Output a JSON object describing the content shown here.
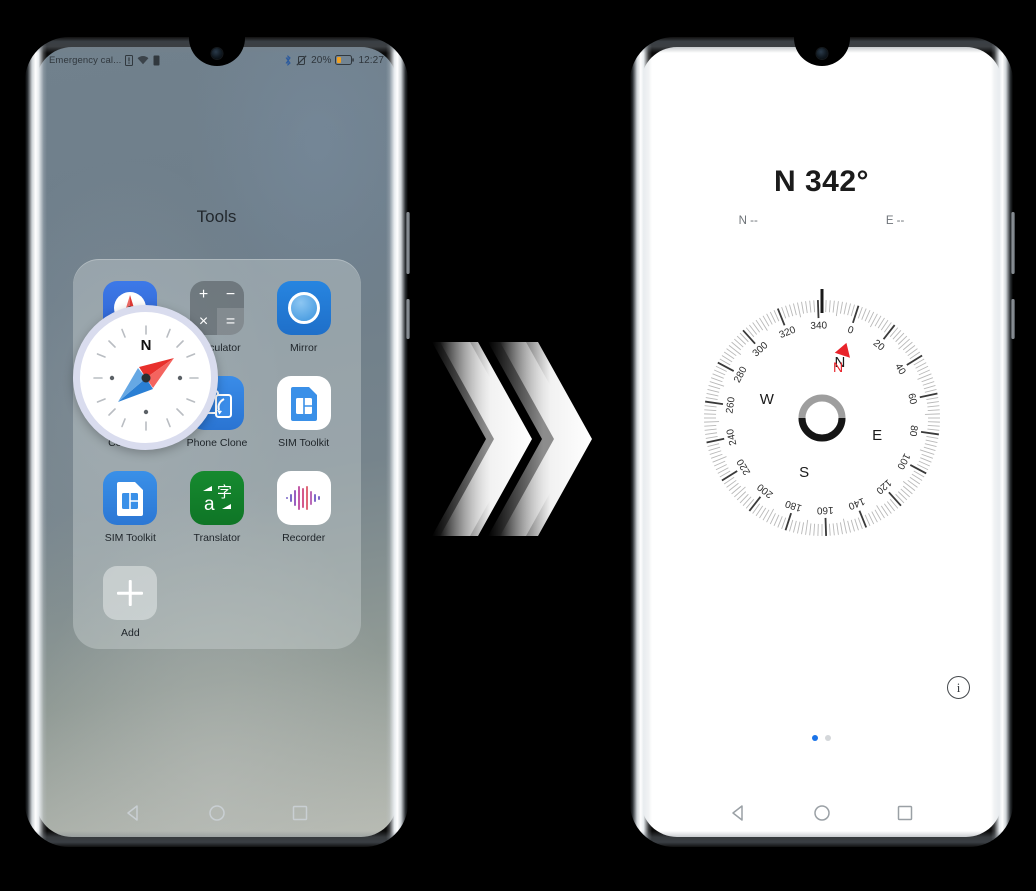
{
  "scene": {
    "title": "Huawei compass app launch flow",
    "accent_blue": "#1a73e8",
    "north_red": "#e8232a"
  },
  "left_phone": {
    "status_bar": {
      "carrier": "Emergency cal...",
      "no_sim_icon": "sim-alert-icon",
      "wifi_icon": "wifi-icon",
      "signal_icon": "signal-bar-icon",
      "bluetooth_icon": "bluetooth-icon",
      "mute_icon": "vibrate-off-icon",
      "battery_percent": "20%",
      "battery_icon": "battery-low-icon",
      "clock": "12:27"
    },
    "folder": {
      "title": "Tools",
      "apps": [
        {
          "label": "Compass",
          "icon": "compass-icon"
        },
        {
          "label": "Calculator",
          "icon": "calculator-icon"
        },
        {
          "label": "Mirror",
          "icon": "mirror-icon"
        },
        {
          "label": "Compass",
          "icon": "compass-icon"
        },
        {
          "label": "Phone Clone",
          "icon": "phone-clone-icon"
        },
        {
          "label": "SIM Toolkit",
          "icon": "sim-toolkit-icon"
        },
        {
          "label": "SIM Toolkit",
          "icon": "sim-toolkit-icon"
        },
        {
          "label": "Translator",
          "icon": "translator-icon"
        },
        {
          "label": "Recorder",
          "icon": "recorder-icon"
        },
        {
          "label": "Add",
          "icon": "plus-icon"
        }
      ]
    },
    "magnifier": {
      "target_app": "Compass",
      "needle_north_label": "N"
    },
    "nav_bar": {
      "back": "back-triangle-icon",
      "home": "home-circle-icon",
      "recents": "recents-square-icon"
    }
  },
  "transition": {
    "icon": "double-chevron-right-icon",
    "count": 2
  },
  "right_phone": {
    "app": "Compass",
    "heading_text": "N 342°",
    "latitude": "N --",
    "longitude": "E --",
    "info_icon": "info-icon",
    "page_dots": {
      "total": 2,
      "active_index": 0
    },
    "nav_bar": {
      "back": "back-triangle-icon",
      "home": "home-circle-icon",
      "recents": "recents-square-icon"
    },
    "compass_dial": {
      "heading_degrees": 342,
      "cardinal_labels": [
        "N",
        "E",
        "S",
        "W"
      ],
      "degree_labels": [
        0,
        20,
        40,
        60,
        80,
        100,
        120,
        140,
        160,
        180,
        200,
        220,
        240,
        260,
        280,
        300,
        320,
        340
      ],
      "north_marker_label": "N",
      "north_marker_color": "#e8232a",
      "fixed_pointer": "top-index-line",
      "bubble_level": "center-bubble-ring"
    }
  }
}
